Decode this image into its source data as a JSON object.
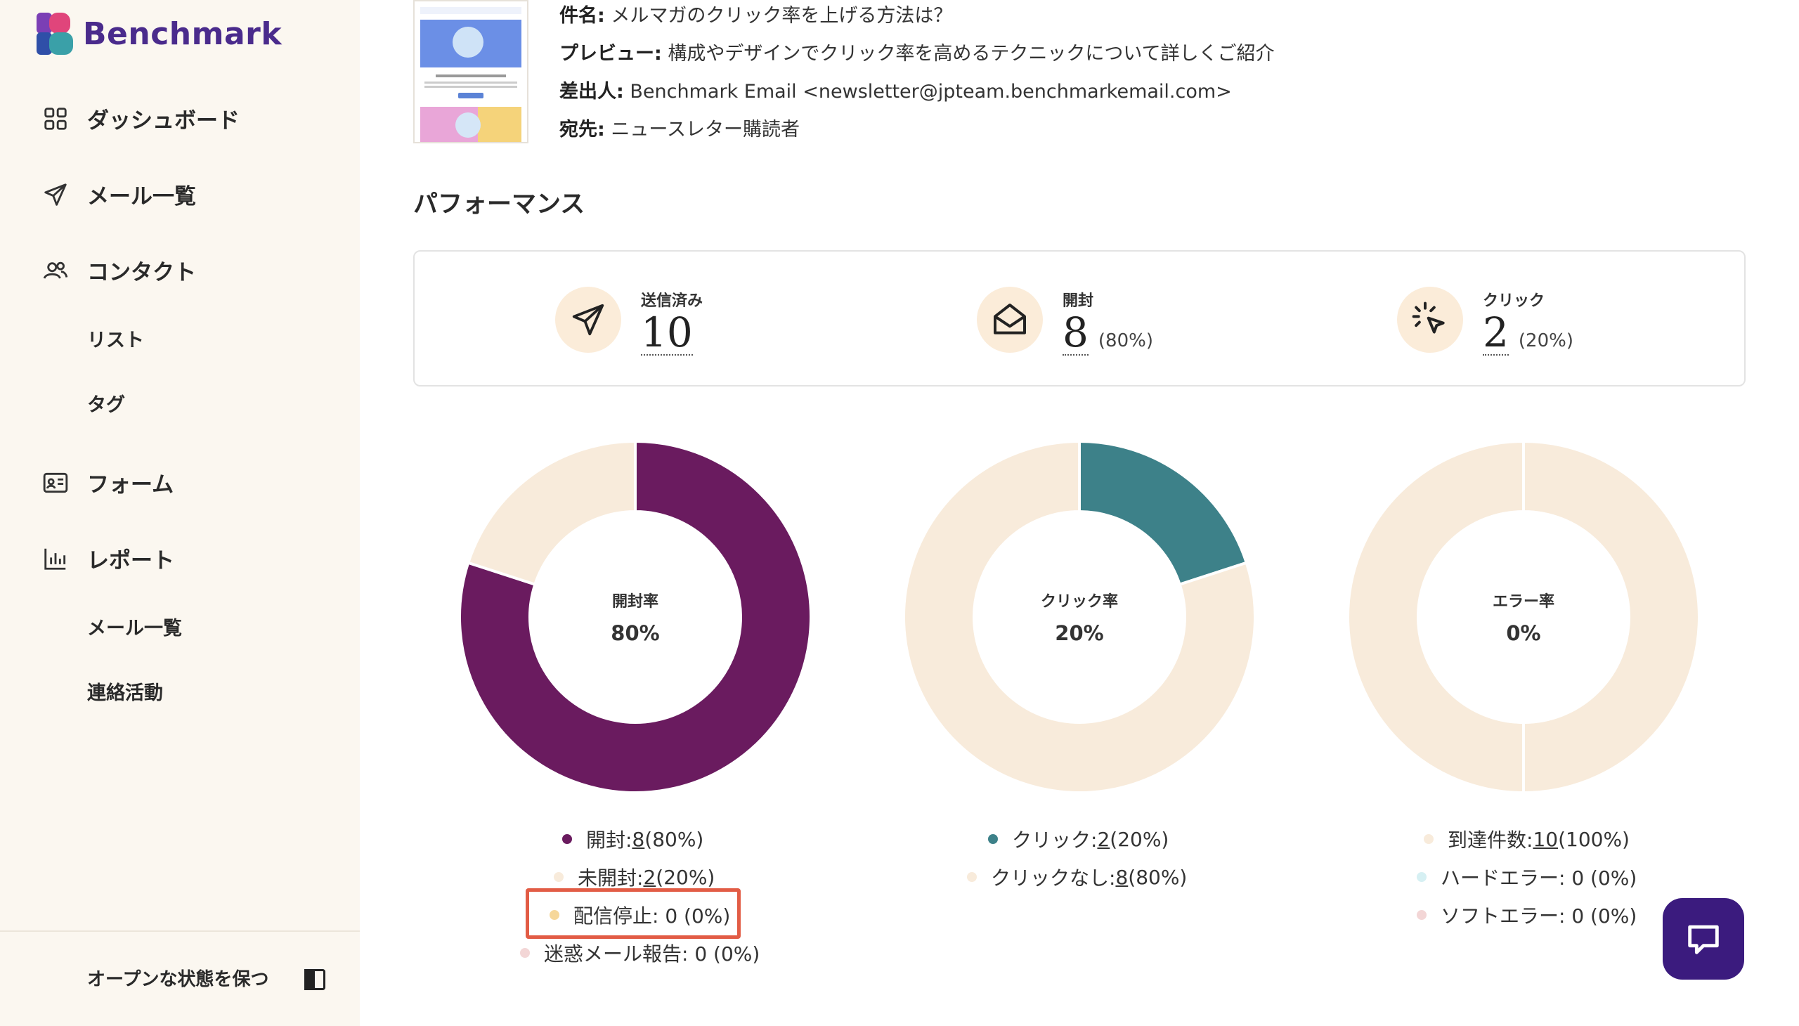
{
  "brand": {
    "name": "Benchmark"
  },
  "sidebar": {
    "items": [
      {
        "label": "ダッシュボード",
        "icon": "grid-icon"
      },
      {
        "label": "メール一覧",
        "icon": "send-icon"
      },
      {
        "label": "コンタクト",
        "icon": "users-icon"
      },
      {
        "label": "リスト"
      },
      {
        "label": "タグ"
      },
      {
        "label": "フォーム",
        "icon": "form-icon"
      },
      {
        "label": "レポート",
        "icon": "bar-chart-icon"
      },
      {
        "label": "メール一覧"
      },
      {
        "label": "連絡活動"
      }
    ],
    "keep_open": "オープンな状態を保つ"
  },
  "email": {
    "subject_label": "件名:",
    "subject": "メルマガのクリック率を上げる方法は？",
    "preview_label": "プレビュー:",
    "preview": "構成やデザインでクリック率を高めるテクニックについて詳しくご紹介",
    "from_label": "差出人:",
    "from": "Benchmark Email <newsletter@jpteam.benchmarkemail.com>",
    "to_label": "宛先:",
    "to": "ニュースレター購読者"
  },
  "performance": {
    "title": "パフォーマンス",
    "stats": [
      {
        "label": "送信済み",
        "value": "10",
        "pct": "",
        "icon": "send-icon"
      },
      {
        "label": "開封",
        "value": "8",
        "pct": "(80%)",
        "icon": "envelope-open-icon"
      },
      {
        "label": "クリック",
        "value": "2",
        "pct": "(20%)",
        "icon": "click-cursor-icon"
      }
    ]
  },
  "charts": [
    {
      "title": "開封率",
      "value": "80%",
      "legend": [
        {
          "label": "開封: ",
          "count": "8",
          "rest": " (80%)",
          "color": "#6a1b5f"
        },
        {
          "label": "未開封: ",
          "count": "2",
          "rest": " (20%)",
          "color": "#f8ebdb"
        },
        {
          "label": "配信停止: 0 (0%)",
          "count": "",
          "rest": "",
          "color": "#f6d79a"
        },
        {
          "label": "迷惑メール報告: 0 (0%)",
          "count": "",
          "rest": "",
          "color": "#f3d6d6"
        }
      ]
    },
    {
      "title": "クリック率",
      "value": "20%",
      "legend": [
        {
          "label": "クリック: ",
          "count": "2",
          "rest": " (20%)",
          "color": "#3d8189"
        },
        {
          "label": "クリックなし: ",
          "count": "8",
          "rest": " (80%)",
          "color": "#f8ebdb"
        }
      ]
    },
    {
      "title": "エラー率",
      "value": "0%",
      "legend": [
        {
          "label": "到達件数: ",
          "count": "10",
          "rest": " (100%)",
          "color": "#f8ebdb"
        },
        {
          "label": "ハードエラー: 0 (0%)",
          "count": "",
          "rest": "",
          "color": "#d6f0f3"
        },
        {
          "label": "ソフトエラー: 0 (0%)",
          "count": "",
          "rest": "",
          "color": "#f3d6d6"
        }
      ]
    }
  ],
  "chart_data": [
    {
      "type": "pie",
      "title": "開封率",
      "categories": [
        "開封",
        "未開封",
        "配信停止",
        "迷惑メール報告"
      ],
      "values": [
        8,
        2,
        0,
        0
      ],
      "colors": [
        "#6a1b5f",
        "#f8ebdb",
        "#f6d79a",
        "#f3d6d6"
      ]
    },
    {
      "type": "pie",
      "title": "クリック率",
      "categories": [
        "クリック",
        "クリックなし"
      ],
      "values": [
        2,
        8
      ],
      "colors": [
        "#3d8189",
        "#f8ebdb"
      ]
    },
    {
      "type": "pie",
      "title": "エラー率",
      "categories": [
        "到達件数",
        "ハードエラー",
        "ソフトエラー"
      ],
      "values": [
        10,
        0,
        0
      ],
      "colors": [
        "#f8ebdb",
        "#d6f0f3",
        "#f3d6d6"
      ]
    }
  ]
}
